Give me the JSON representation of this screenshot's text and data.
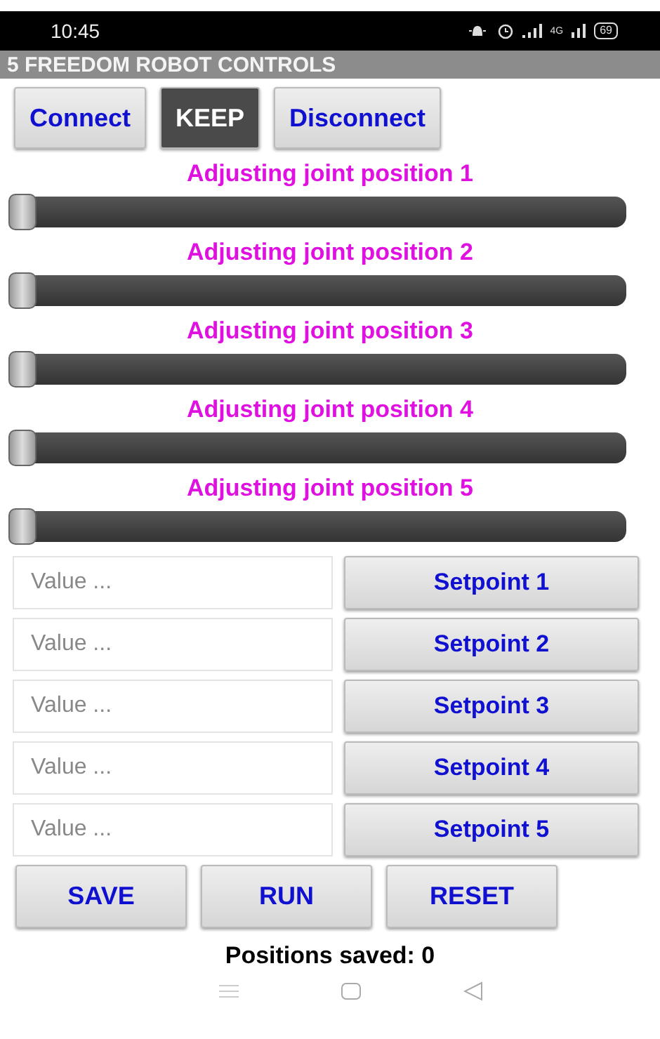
{
  "status_bar": {
    "time": "10:45",
    "network": "4G",
    "battery": "69"
  },
  "title_bar": {
    "title": "5 FREEDOM ROBOT CONTROLS"
  },
  "connection_buttons": [
    {
      "label": "Connect",
      "selected": false
    },
    {
      "label": "KEEP",
      "selected": true
    },
    {
      "label": "Disconnect",
      "selected": false
    }
  ],
  "joints": [
    {
      "label": "Adjusting joint position 1",
      "level": 0
    },
    {
      "label": "Adjusting joint position 2",
      "level": 0
    },
    {
      "label": "Adjusting joint position 3",
      "level": 0
    },
    {
      "label": "Adjusting joint position 4",
      "level": 0
    },
    {
      "label": "Adjusting joint position 5",
      "level": 0
    }
  ],
  "setpoints": [
    {
      "placeholder": "Value ...",
      "button": "Setpoint 1"
    },
    {
      "placeholder": "Value ...",
      "button": "Setpoint 2"
    },
    {
      "placeholder": "Value ...",
      "button": "Setpoint 3"
    },
    {
      "placeholder": "Value ...",
      "button": "Setpoint 4"
    },
    {
      "placeholder": "Value ...",
      "button": "Setpoint 5"
    }
  ],
  "action_buttons": [
    "SAVE",
    "RUN",
    "RESET"
  ],
  "positions_saved": "Positions saved:  0"
}
